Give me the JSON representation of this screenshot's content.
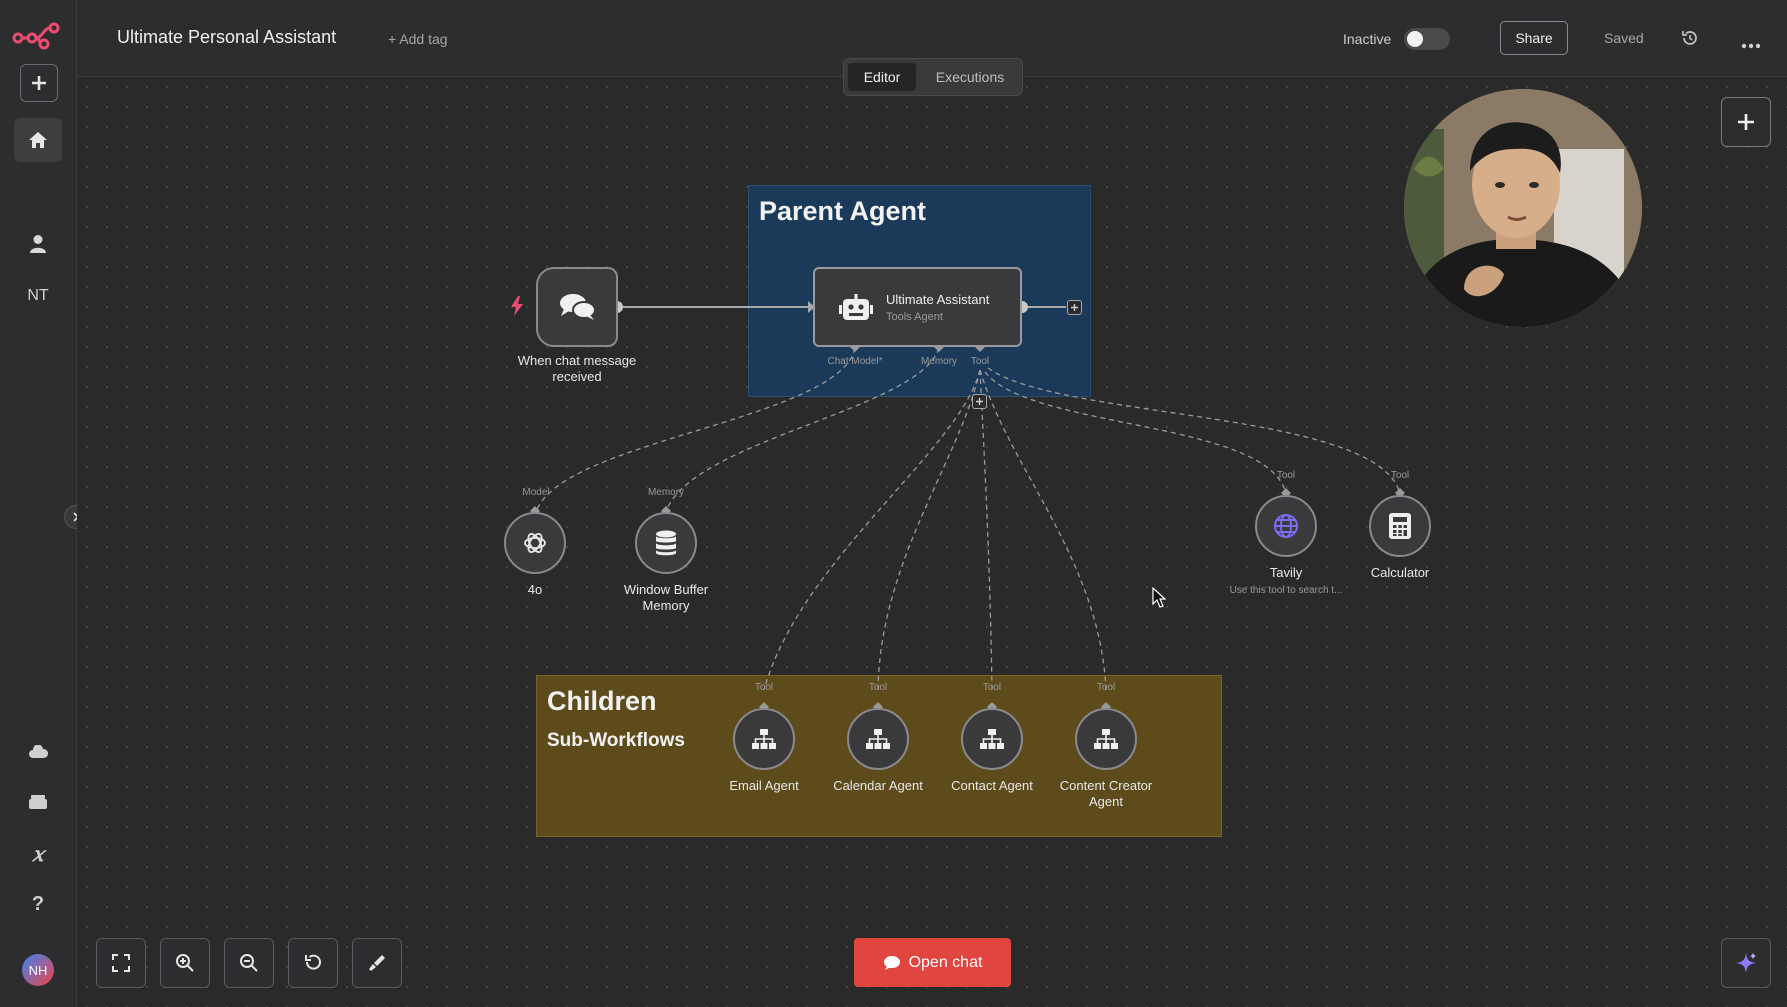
{
  "app": {
    "workflow_title": "Ultimate Personal Assistant",
    "add_tag": "+ Add tag"
  },
  "sidebar": {
    "user_initials": "NT",
    "avatar_initials": "NH"
  },
  "header": {
    "status_label": "Inactive",
    "active": false,
    "share_label": "Share",
    "saved_label": "Saved",
    "tabs": [
      {
        "label": "Editor",
        "selected": true
      },
      {
        "label": "Executions",
        "selected": false
      }
    ]
  },
  "groups": {
    "parent": {
      "title": "Parent Agent",
      "color": "#1b3a5a"
    },
    "children": {
      "title": "Children",
      "subtitle": "Sub-Workflows",
      "color": "#5e4b1c"
    }
  },
  "nodes": {
    "trigger": {
      "label": "When chat message received"
    },
    "agent": {
      "title": "Ultimate Assistant",
      "subtitle": "Tools Agent",
      "ports": [
        "Chat Model*",
        "Memory",
        "Tool"
      ]
    },
    "model": {
      "port": "Model",
      "label": "4o"
    },
    "memory": {
      "port": "Memory",
      "label": "Window Buffer Memory"
    },
    "tavily": {
      "port": "Tool",
      "label": "Tavily",
      "sublabel": "Use this tool to search t..."
    },
    "calculator": {
      "port": "Tool",
      "label": "Calculator"
    },
    "email": {
      "port": "Tool",
      "label": "Email Agent"
    },
    "calendar": {
      "port": "Tool",
      "label": "Calendar Agent"
    },
    "contact": {
      "port": "Tool",
      "label": "Contact Agent"
    },
    "content": {
      "port": "Tool",
      "label": "Content Creator Agent"
    }
  },
  "footer": {
    "open_chat_label": "Open chat"
  },
  "colors": {
    "accent": "#ea4b71",
    "open_chat": "#e0463f",
    "tavily": "#7b6cf0"
  },
  "icons": [
    "n8n-logo",
    "plus-icon",
    "home-icon",
    "user-icon",
    "chevron-right-icon",
    "cloud-icon",
    "templates-icon",
    "variables-icon",
    "help-icon",
    "history-icon",
    "more-icon",
    "lightning-icon",
    "chat-bubbles-icon",
    "robot-icon",
    "openai-icon",
    "database-icon",
    "globe-icon",
    "calculator-icon",
    "sitemap-icon",
    "fit-view-icon",
    "zoom-in-icon",
    "zoom-out-icon",
    "reset-zoom-icon",
    "tidy-up-icon",
    "sparkle-icon"
  ]
}
